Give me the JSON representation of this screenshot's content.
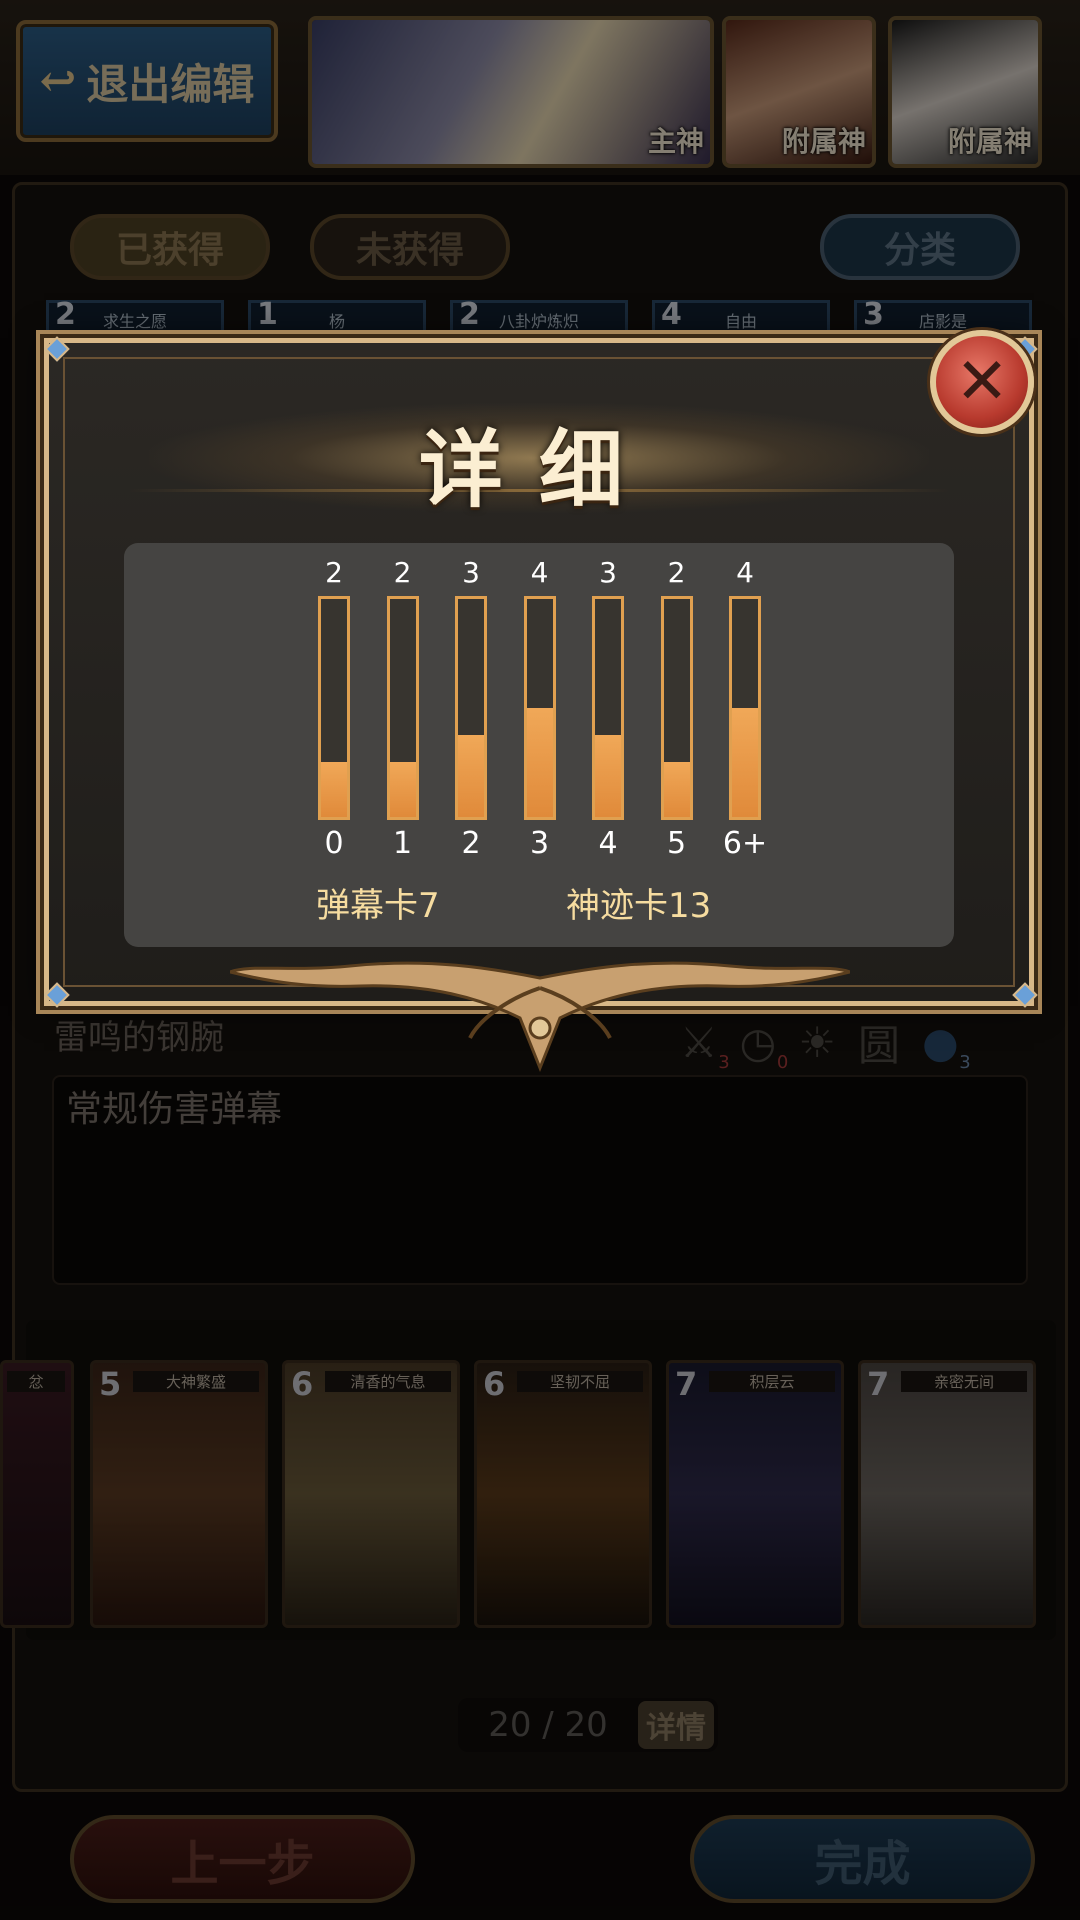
{
  "top_bar": {
    "exit_label": "退出编辑",
    "god_cards": [
      {
        "tag": "主神"
      },
      {
        "tag": "附属神"
      },
      {
        "tag": "附属神"
      }
    ]
  },
  "tabs": {
    "obtained": "已获得",
    "not_obtained": "未获得",
    "category": "分类"
  },
  "mini_cards": [
    {
      "cost": "2",
      "name": "求生之愿"
    },
    {
      "cost": "1",
      "name": "杨"
    },
    {
      "cost": "2",
      "name": "八卦炉炼炽"
    },
    {
      "cost": "4",
      "name": "自由"
    },
    {
      "cost": "3",
      "name": "店影是"
    }
  ],
  "card_detail": {
    "name": "雷鸣的钢腕",
    "stats": [
      {
        "icon": "sword-icon",
        "value": "3"
      },
      {
        "icon": "clock-icon",
        "value": "0"
      },
      {
        "icon": "sun-icon",
        "value": ""
      },
      {
        "icon": "circle-char",
        "value": "圆"
      },
      {
        "icon": "wind-icon",
        "value": "3"
      }
    ],
    "description": "常规伤害弹幕"
  },
  "deck_cards": [
    {
      "cost": "",
      "name": "忿"
    },
    {
      "cost": "5",
      "name": "大神繁盛"
    },
    {
      "cost": "6",
      "name": "清香的气息"
    },
    {
      "cost": "6",
      "name": "坚韧不屈"
    },
    {
      "cost": "7",
      "name": "积层云"
    },
    {
      "cost": "7",
      "name": "亲密无间"
    }
  ],
  "deck_counter": {
    "count": "20 / 20",
    "details_label": "详情"
  },
  "bottom_buttons": {
    "prev": "上一步",
    "done": "完成"
  },
  "modal": {
    "title": "详细",
    "close_icon": "close-icon",
    "chart_data": {
      "type": "bar",
      "title": "",
      "categories": [
        "0",
        "1",
        "2",
        "3",
        "4",
        "5",
        "6+"
      ],
      "values": [
        2,
        2,
        3,
        4,
        3,
        2,
        4
      ],
      "ylim": [
        0,
        8
      ],
      "bar_color": "#e8964a",
      "track_color": "#37342f"
    },
    "danmaku_cards": "弹幕卡7",
    "miracle_cards": "神迹卡13"
  },
  "colors": {
    "accent_gold": "#d8b888",
    "title_text": "#fbeed2",
    "close_red": "#b83a2e",
    "label_gold": "#f6dca0"
  }
}
